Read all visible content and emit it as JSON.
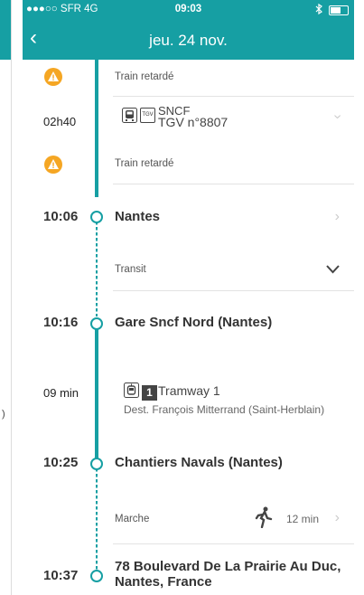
{
  "status": {
    "carrier": "●●●○○ SFR 4G",
    "time": "09:03"
  },
  "nav": {
    "title": "jeu. 24 nov."
  },
  "left_edge_mark": ")",
  "rows": {
    "delay1": {
      "label": "Train retardé"
    },
    "train": {
      "duration": "02h40",
      "operator": "SNCF",
      "line": "TGV n°8807",
      "badge": "TGV"
    },
    "delay2": {
      "label": "Train retardé"
    },
    "nantes": {
      "time": "10:06",
      "name": "Nantes"
    },
    "transit": {
      "label": "Transit"
    },
    "gare_nord": {
      "time": "10:16",
      "name": "Gare Sncf Nord (Nantes)"
    },
    "tram": {
      "duration": "09 min",
      "number": "1",
      "line": "Tramway 1",
      "dest": "Dest. François Mitterrand (Saint-Herblain)"
    },
    "chantiers": {
      "time": "10:25",
      "name": "Chantiers Navals (Nantes)"
    },
    "walk": {
      "label": "Marche",
      "duration": "12 min"
    },
    "arrival": {
      "time": "10:37",
      "name": "78 Boulevard De La Prairie Au Duc, Nantes, France"
    }
  },
  "colors": {
    "accent": "#169fa3",
    "warning": "#f5a623"
  }
}
